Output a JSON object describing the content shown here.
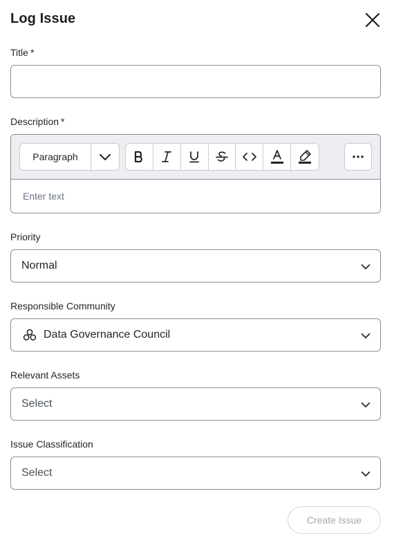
{
  "header": {
    "title": "Log Issue"
  },
  "fields": {
    "title": {
      "label": "Title",
      "required_mark": "*",
      "value": ""
    },
    "description": {
      "label": "Description",
      "required_mark": "*",
      "toolbar": {
        "paragraph_label": "Paragraph"
      },
      "placeholder": "Enter text"
    },
    "priority": {
      "label": "Priority",
      "value": "Normal"
    },
    "community": {
      "label": "Responsible Community",
      "value": "Data Governance Council"
    },
    "assets": {
      "label": "Relevant Assets",
      "value": "Select"
    },
    "classification": {
      "label": "Issue Classification",
      "value": "Select"
    }
  },
  "footer": {
    "create_label": "Create Issue"
  }
}
